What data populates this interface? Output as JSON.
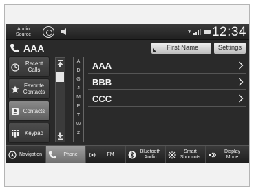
{
  "status_bar": {
    "audio_source_label": [
      "Audio",
      "Source"
    ],
    "bluetooth_symbol": "∗",
    "clock": "12:34"
  },
  "header": {
    "contact_name": "AAA",
    "sort_label": "First Name",
    "settings_label": "Settings"
  },
  "left_menu": [
    {
      "label": [
        "Recent",
        "Calls"
      ],
      "icon": "clock-icon",
      "active": false
    },
    {
      "label": [
        "Favorite",
        "Contacts"
      ],
      "icon": "star-icon",
      "active": false
    },
    {
      "label": [
        "Contacts"
      ],
      "icon": "contacts-icon",
      "active": true
    },
    {
      "label": [
        "Keypad"
      ],
      "icon": "keypad-icon",
      "active": false
    }
  ],
  "alpha_index": [
    "A",
    "D",
    "G",
    "J",
    "M",
    "P",
    "T",
    "W",
    "#"
  ],
  "contacts": [
    "AAA",
    "BBB",
    "CCC"
  ],
  "bottom_nav": [
    {
      "label": [
        "Navigation"
      ],
      "icon": "navigation-icon",
      "active": false
    },
    {
      "label": [
        "Phone"
      ],
      "icon": "phone-icon",
      "active": true
    },
    {
      "label": [
        "FM"
      ],
      "icon": "radio-icon",
      "active": false
    },
    {
      "label": [
        "Bluetooth",
        "Audio"
      ],
      "icon": "bluetooth-icon",
      "active": false
    },
    {
      "label": [
        "Smart",
        "Shortcuts"
      ],
      "icon": "shortcuts-icon",
      "active": false
    },
    {
      "label": [
        "Display",
        "Mode"
      ],
      "icon": "display-mode-icon",
      "active": false
    }
  ]
}
